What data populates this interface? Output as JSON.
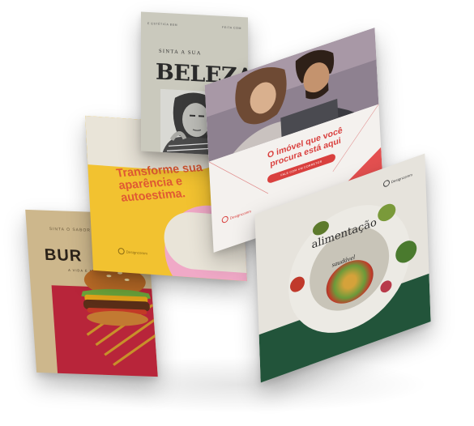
{
  "cards": {
    "burger": {
      "tagline": "SINTA O SABOR",
      "title": "BUR",
      "subtitle": "A VIDA É MAIS SABOROSA"
    },
    "yellow": {
      "headline": "Transforme sua aparência e autoestima.",
      "logo": "Designcomm"
    },
    "beleza": {
      "top_left": "E ESTÉTICA BEM",
      "top_right": "FEITA COM",
      "kicker": "SINTA A SUA",
      "title": "BELEZA"
    },
    "imovel": {
      "headline": "O imóvel que você procura está aqui",
      "cta": "FALE COM UM CORRETOR",
      "logo": "Designcomm"
    },
    "food": {
      "title": "alimentação",
      "subtitle": "saudável",
      "logo": "Designcomm"
    }
  },
  "colors": {
    "burger_bg": "#cdb78c",
    "burger_red": "#b8253a",
    "yellow_bg": "#f2c230",
    "pink": "#f0a9c7",
    "accent_red": "#d9403e",
    "food_green": "#22543a"
  }
}
